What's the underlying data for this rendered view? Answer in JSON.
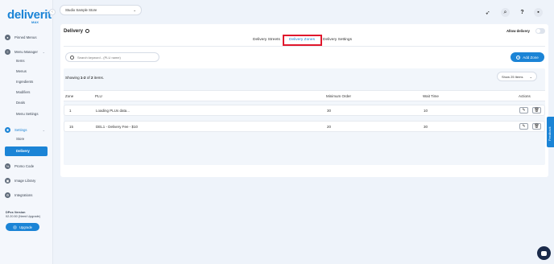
{
  "logo": {
    "main": "deliverit",
    "sub": "MAX"
  },
  "sidebar": {
    "items": [
      {
        "label": "Pinned Menus",
        "icon": "pin-icon"
      },
      {
        "label": "Menu Manager",
        "icon": "menu-icon",
        "children": [
          "Items",
          "Menus",
          "Ingredients",
          "Modifiers",
          "Deals",
          "Menu Settings"
        ]
      },
      {
        "label": "Settings",
        "icon": "gear-icon",
        "active": true,
        "children": [
          "Store",
          "Delivery"
        ]
      },
      {
        "label": "Promo Code",
        "icon": "tag-icon"
      },
      {
        "label": "Image Library",
        "icon": "image-icon"
      },
      {
        "label": "Integrations",
        "icon": "plug-icon"
      }
    ],
    "active_sub": "Delivery"
  },
  "version": {
    "title": "DPos Version",
    "value": "02.20.50 (Need Upgrade)"
  },
  "upgrade_label": "Upgrade",
  "header": {
    "store_select": "Studio Sample Store"
  },
  "page": {
    "title": "Delivery",
    "allow_delivery_label": "Allow delivery",
    "allow_delivery_on": false
  },
  "tabs": [
    {
      "label": "Delivery Streets",
      "active": false
    },
    {
      "label": "Delivery Zones",
      "active": true
    },
    {
      "label": "Delivery Settings",
      "active": false
    }
  ],
  "search": {
    "placeholder": "Search keyword - (PLU name)"
  },
  "add_zone_label": "Add Zone",
  "summary": {
    "prefix": "Showing ",
    "range": "1-2",
    "of": " of ",
    "total": "2",
    "suffix": " items."
  },
  "page_size": "Show 25 Items",
  "table": {
    "headers": [
      "Zone",
      "PLU",
      "Minimum Order",
      "Wait Time",
      "Actions"
    ],
    "rows": [
      {
        "zone": "1",
        "plu": "Loading PLUs data...",
        "min_order": "30",
        "wait": "10"
      },
      {
        "zone": "15",
        "plu": "DEL1 - Delivery Fee - $10",
        "min_order": "20",
        "wait": "30"
      }
    ]
  },
  "feedback_label": "Feedback",
  "colors": {
    "accent": "#1b84d6",
    "highlight": "#e0182d"
  }
}
